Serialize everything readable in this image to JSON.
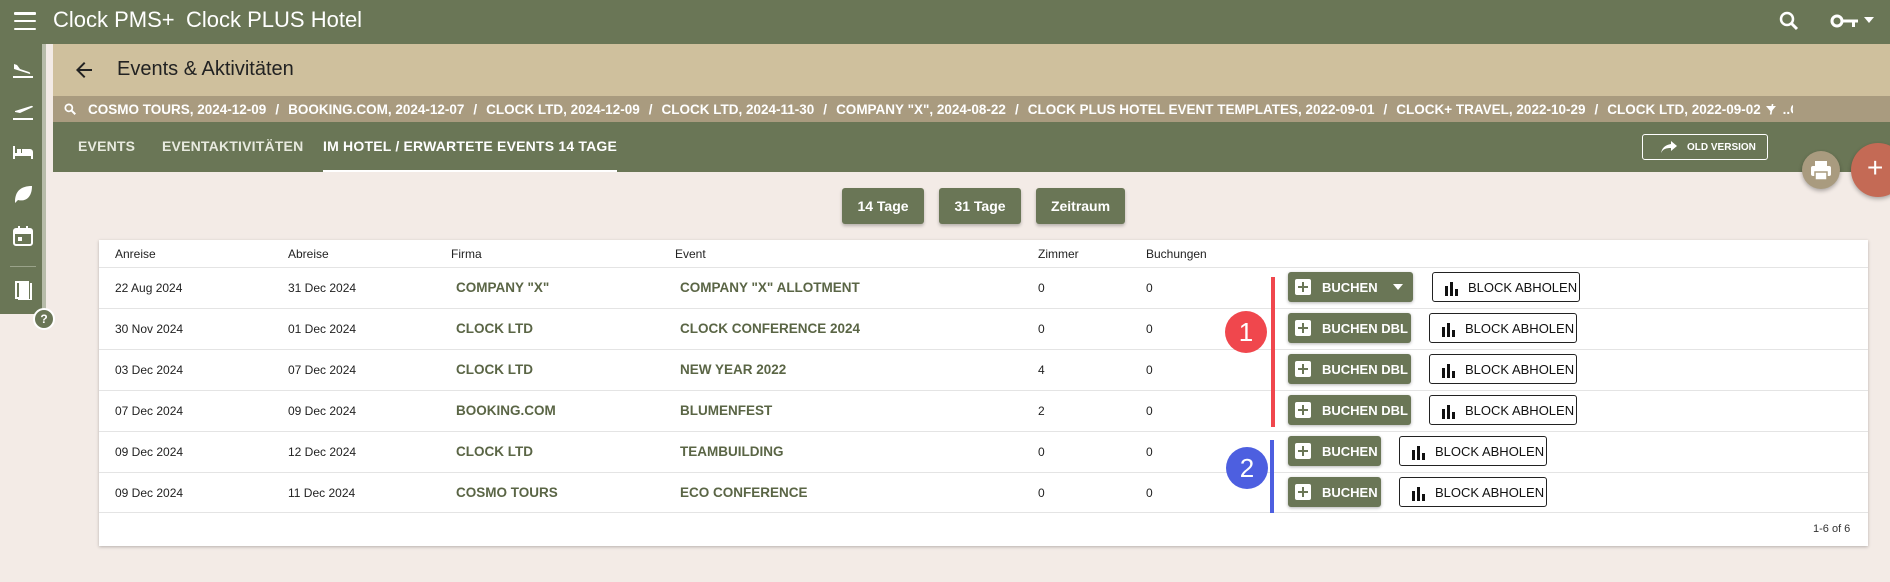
{
  "app": {
    "brand": "Clock PMS+",
    "hotel": "Clock PLUS Hotel"
  },
  "page": {
    "title": "Events & Aktivitäten"
  },
  "breadcrumbs": [
    "COSMO TOURS, 2024-12-09",
    "BOOKING.COM, 2024-12-07",
    "CLOCK LTD, 2024-12-09",
    "CLOCK LTD, 2024-11-30",
    "COMPANY \"X\", 2024-08-22",
    "CLOCK PLUS HOTEL EVENT TEMPLATES, 2022-09-01",
    "CLOCK+ TRAVEL, 2022-10-29",
    "CLOCK LTD, 2022-09-02",
    "..C"
  ],
  "tabs": [
    {
      "label": "EVENTS"
    },
    {
      "label": "EVENTAKTIVITÄTEN"
    },
    {
      "label": "IM HOTEL / ERWARTETE EVENTS 14 TAGE"
    }
  ],
  "old_version_label": "OLD VERSION",
  "ranges": [
    "14 Tage",
    "31 Tage",
    "Zeitraum"
  ],
  "table": {
    "headers": [
      "Anreise",
      "Abreise",
      "Firma",
      "Event",
      "Zimmer",
      "Buchungen"
    ],
    "rows": [
      {
        "arrival": "22 Aug 2024",
        "departure": "31 Dec 2024",
        "company": "COMPANY \"X\"",
        "event": "COMPANY \"X\" ALLOTMENT",
        "rooms": "0",
        "bookings": "0",
        "book": "BUCHEN",
        "block": "BLOCK ABHOLEN"
      },
      {
        "arrival": "30 Nov 2024",
        "departure": "01 Dec 2024",
        "company": "CLOCK LTD",
        "event": "CLOCK CONFERENCE 2024",
        "rooms": "0",
        "bookings": "0",
        "book": "BUCHEN DBL",
        "block": "BLOCK ABHOLEN"
      },
      {
        "arrival": "03 Dec 2024",
        "departure": "07 Dec 2024",
        "company": "CLOCK LTD",
        "event": "NEW YEAR 2022",
        "rooms": "4",
        "bookings": "0",
        "book": "BUCHEN DBL",
        "block": "BLOCK ABHOLEN"
      },
      {
        "arrival": "07 Dec 2024",
        "departure": "09 Dec 2024",
        "company": "BOOKING.COM",
        "event": "BLUMENFEST",
        "rooms": "2",
        "bookings": "0",
        "book": "BUCHEN DBL",
        "block": "BLOCK ABHOLEN"
      },
      {
        "arrival": "09 Dec 2024",
        "departure": "12 Dec 2024",
        "company": "CLOCK LTD",
        "event": "TEAMBUILDING",
        "rooms": "0",
        "bookings": "0",
        "book": "BUCHEN",
        "block": "BLOCK ABHOLEN"
      },
      {
        "arrival": "09 Dec 2024",
        "departure": "11 Dec 2024",
        "company": "COSMO TOURS",
        "event": "ECO CONFERENCE",
        "rooms": "0",
        "bookings": "0",
        "book": "BUCHEN",
        "block": "BLOCK ABHOLEN"
      }
    ],
    "pager": "1-6 of 6"
  },
  "annotations": {
    "marker_1": "1",
    "marker_2": "2",
    "red": "#f0474d",
    "blue": "#4d5fe0"
  },
  "help": "?",
  "colors": {
    "header_green": "#6a7656",
    "title_tan": "#cfc09d",
    "crumb_tan": "#a99b7f",
    "fab_add": "#c46a55"
  },
  "icons": [
    "menu-icon",
    "search-icon",
    "key-icon",
    "arrival-icon",
    "departure-icon",
    "bed-icon",
    "leaf-icon",
    "calendar-icon",
    "book-icon",
    "back-arrow-icon",
    "share-icon",
    "print-icon",
    "plus-icon",
    "bar-chart-icon"
  ]
}
